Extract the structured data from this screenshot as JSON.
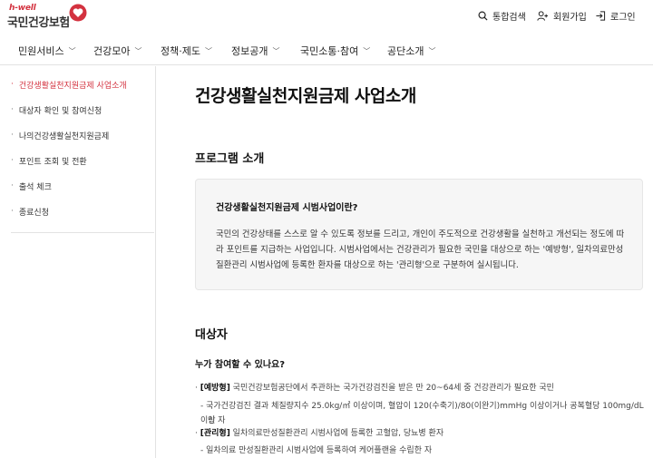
{
  "logo": {
    "top": "h-well",
    "main": "국민건강보험"
  },
  "util": {
    "search": "통합검색",
    "join": "회원가입",
    "login": "로그인"
  },
  "gnb": [
    {
      "label": "민원서비스"
    },
    {
      "label": "건강모아"
    },
    {
      "label": "정책·제도"
    },
    {
      "label": "정보공개"
    },
    {
      "label": "국민소통·참여"
    },
    {
      "label": "공단소개"
    }
  ],
  "sidebar": {
    "items": [
      {
        "label": "건강생활실천지원금제 사업소개",
        "active": true
      },
      {
        "label": "대상자 확인 및 참여신청"
      },
      {
        "label": "나의건강생활실천지원금제"
      },
      {
        "label": "포인트 조회 및 전환"
      },
      {
        "label": "출석 체크"
      },
      {
        "label": "종료신청"
      }
    ]
  },
  "main": {
    "title": "건강생활실천지원금제 사업소개",
    "program": {
      "heading": "프로그램 소개",
      "box_title": "건강생활실천지원금제 시범사업이란?",
      "box_text": "국민의 건강상태를 스스로 알 수 있도록 정보를 드리고, 개인이 주도적으로 건강생활을 실천하고 개선되는 정도에 따라 포인트를 지급하는 사업입니다. 시범사업에서는 건강관리가 필요한 국민을 대상으로 하는 '예방형', 일차의료만성질환관리 시범사업에 등록한 환자를 대상으로 하는 '관리형'으로 구분하여 실시됩니다."
    },
    "target": {
      "heading": "대상자",
      "question": "누가 참여할 수 있나요?",
      "b1_tag": "[예방형]",
      "b1_text": " 국민건강보험공단에서 주관하는 국가건강검진을 받은 만 20~64세 중 건강관리가 필요한 국민",
      "s1_line1": "- 국가건강검진 결과 체질량지수 25.0kg/㎡ 이상이며, 혈압이 120(수축기)/80(이완기)mmHg 이상이거나 공복혈당 100mg/dL 이상",
      "s1_line2": "인 자",
      "b2_tag": "[관리형]",
      "b2_text": " 일차의료만성질환관리 시범사업에 등록한 고혈압, 당뇨병 환자",
      "s2_line1": "- 일차의료 만성질환관리 시범사업에 등록하여 케어플랜을 수립한 자"
    }
  },
  "colors": {
    "accent": "#d3323f"
  }
}
